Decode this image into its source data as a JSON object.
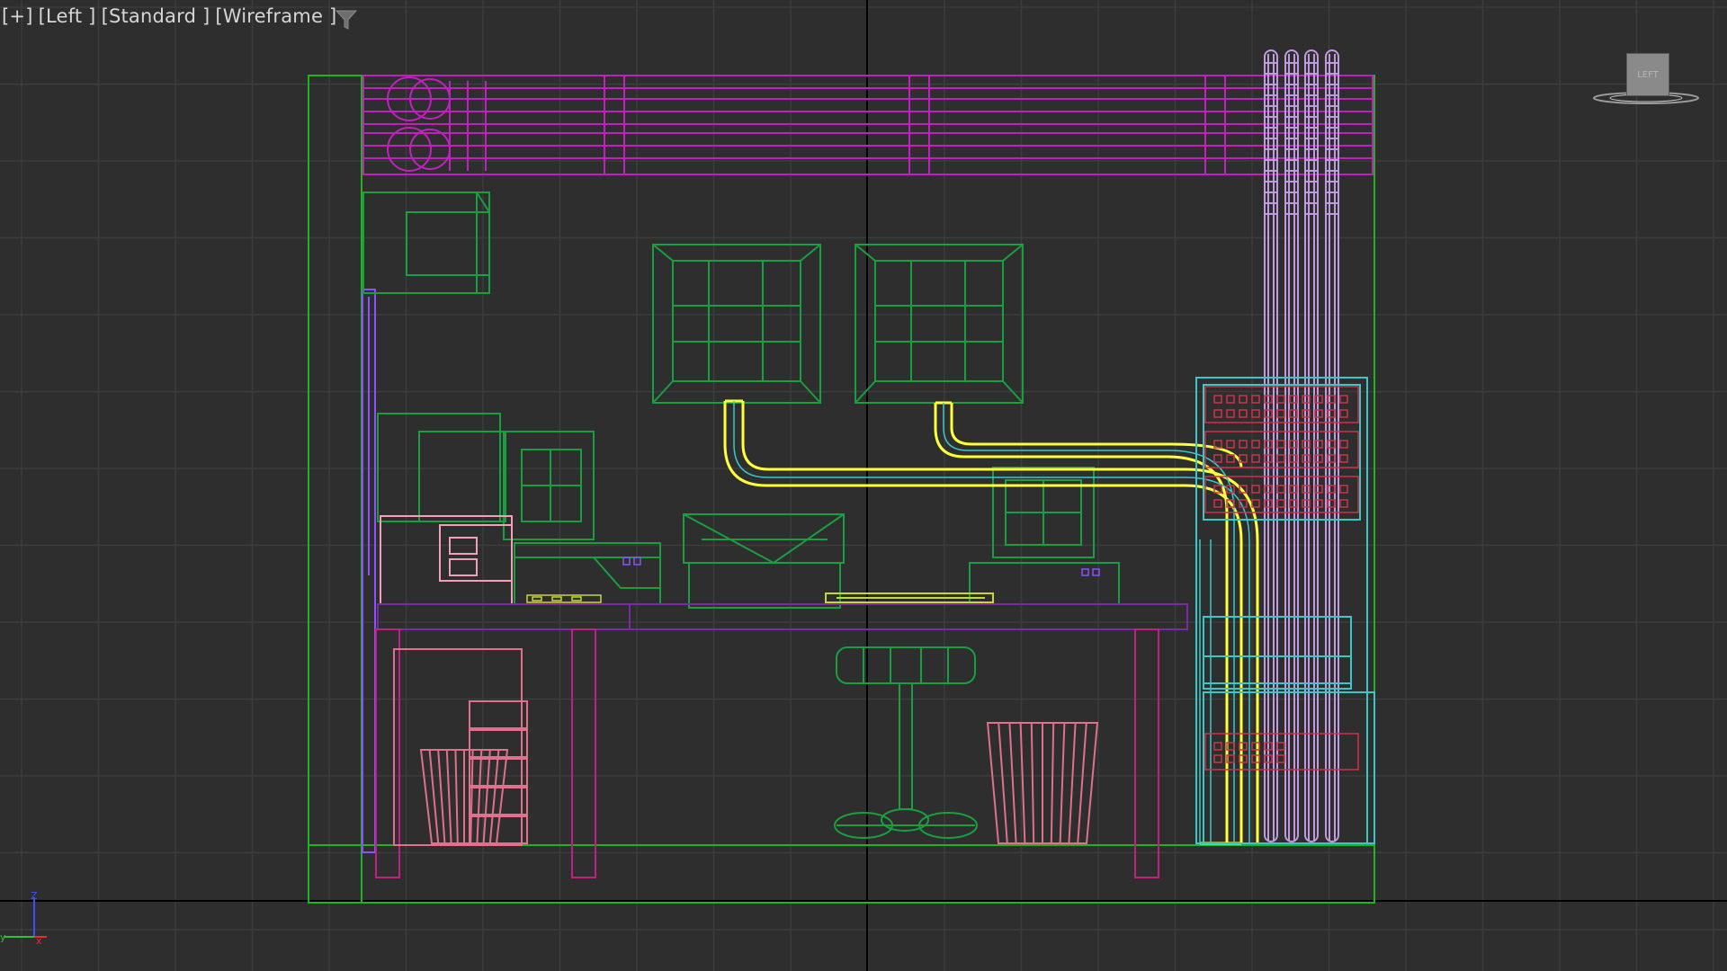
{
  "viewport": {
    "label_parts": [
      "[+]",
      "[Left ]",
      "[Standard ]",
      "[Wireframe ]"
    ],
    "view_name": "Left",
    "viewcube_face": "LEFT",
    "axis_labels": {
      "z": "Z",
      "y": "y",
      "x": "x"
    }
  },
  "colors": {
    "background": "#2e2e2e",
    "grid": "#3c3c3c",
    "grid_major": "#000000",
    "room": "#1db41d",
    "pipes_magenta": "#c020c0",
    "cables_lavender": "#c09adf",
    "duct_selected": "#ffff3c",
    "furniture_green": "#18a040",
    "rack_cyan": "#38c8c8",
    "red_detail": "#d0304a",
    "pink_furniture": "#e0708c",
    "desk_purple": "#7a2aa8",
    "wall_panel_violet": "#8c50ff"
  },
  "icons": {
    "filter": "filter-funnel-icon",
    "viewcube": "viewcube-icon",
    "axis": "axis-tripod-icon"
  }
}
